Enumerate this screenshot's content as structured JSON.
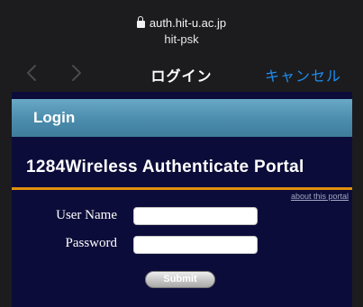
{
  "browser": {
    "host": "auth.hit-u.ac.jp",
    "ssid": "hit-psk"
  },
  "nav": {
    "title": "ログイン",
    "cancel_label": "キャンセル",
    "back_icon": "chevron-left-icon",
    "forward_icon": "chevron-right-icon"
  },
  "page": {
    "header": "Login",
    "portal_title": "1284Wireless Authenticate Portal",
    "about_link": "about this portal",
    "form": {
      "username_label": "User Name",
      "username_value": "",
      "password_label": "Password",
      "password_value": "",
      "submit_label": "Submit"
    }
  },
  "colors": {
    "page_background": "#0c0c3a",
    "header_bar": "#4b8cad",
    "accent_rule": "#e0900f",
    "cancel_link": "#1f8cf0"
  }
}
